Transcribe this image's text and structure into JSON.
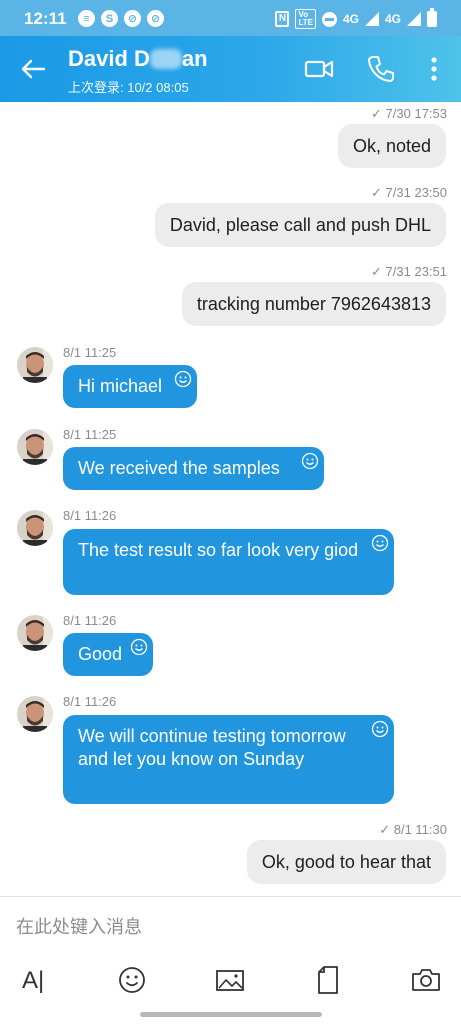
{
  "status_bar": {
    "time": "12:11",
    "network_label": "4G"
  },
  "header": {
    "contact_name_start": "David D",
    "contact_name_end": "an",
    "last_seen": "上次登录: 10/2 08:05"
  },
  "messages": [
    {
      "direction": "out",
      "meta": "7/30 17:53",
      "text": "Ok, noted"
    },
    {
      "direction": "out",
      "meta": "7/31 23:50",
      "text": "David, please call and push DHL"
    },
    {
      "direction": "out",
      "meta": "7/31 23:51",
      "text": "tracking number 7962643813"
    },
    {
      "direction": "in",
      "meta": "8/1 11:25",
      "text": "Hi michael"
    },
    {
      "direction": "in",
      "meta": "8/1 11:25",
      "text": "We received the samples"
    },
    {
      "direction": "in",
      "meta": "8/1 11:26",
      "text": "The test result so far look very giod"
    },
    {
      "direction": "in",
      "meta": "8/1 11:26",
      "text": "Good"
    },
    {
      "direction": "in",
      "meta": "8/1 11:26",
      "text": "We will continue testing tomorrow and let you know on Sunday"
    },
    {
      "direction": "out",
      "meta": "8/1 11:30",
      "text": "Ok, good to hear that"
    }
  ],
  "compose": {
    "placeholder": "在此处键入消息",
    "format_label": "A|"
  },
  "colors": {
    "incoming_bubble": "#2196de",
    "outgoing_bubble": "#ececec",
    "header_accent": "#1a9ae6"
  },
  "icons": [
    "back-arrow-icon",
    "video-call-icon",
    "phone-call-icon",
    "more-options-icon",
    "emoji-icon",
    "image-icon",
    "file-icon",
    "camera-icon",
    "add-reaction-icon",
    "read-check-icon"
  ]
}
